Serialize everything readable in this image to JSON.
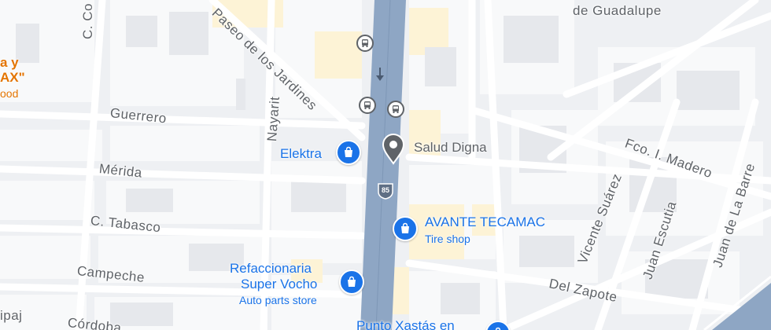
{
  "map": {
    "colors": {
      "background": "#eef0f3",
      "block": "#f8f9fa",
      "building": "#e3e6ea",
      "highlight_block": "#fdf3d6",
      "street": "#ffffff",
      "major_road": "#8ea6c4",
      "poi_blue": "#1a73e8",
      "poi_gray": "#5f6368",
      "label": "#5f6368"
    },
    "street_labels": [
      {
        "text": "C. Co",
        "angle": -90
      },
      {
        "text": "Paseo de los Jardines",
        "angle": 44
      },
      {
        "text": "Nayarit",
        "angle": -86
      },
      {
        "text": "Guerrero",
        "angle": 6
      },
      {
        "text": "Mérida",
        "angle": 6
      },
      {
        "text": "C. Tabasco",
        "angle": 6
      },
      {
        "text": "Campeche",
        "angle": 6
      },
      {
        "text": "Córdoba",
        "angle": 6
      },
      {
        "text": "Fco. I. Madero",
        "angle": 20
      },
      {
        "text": "Vicente Suárez",
        "angle": -68
      },
      {
        "text": "Juan Escutia",
        "angle": -72
      },
      {
        "text": "Juan de La Barre",
        "angle": -72
      },
      {
        "text": "Del Zapote",
        "angle": 12
      },
      {
        "text": "de Guadalupe",
        "angle": 0
      },
      {
        "text": "ipaj",
        "angle": 0
      }
    ],
    "edge_place": {
      "line1": "a y",
      "line2": "AX\"",
      "category": "ood"
    },
    "pois": [
      {
        "name": "Elektra",
        "type": "shopping",
        "color": "#1a73e8",
        "icon": "shopping-bag-icon"
      },
      {
        "name": "Salud Digna",
        "type": "place",
        "color": "#5f6368",
        "icon": "location-pin-icon"
      },
      {
        "name": "AVANTE TECAMAC",
        "category": "Tire shop",
        "type": "shopping",
        "color": "#1a73e8",
        "icon": "shopping-bag-icon"
      },
      {
        "name_line1": "Refaccionaria",
        "name_line2": "Super Vocho",
        "category": "Auto parts store",
        "type": "shopping",
        "color": "#1a73e8",
        "icon": "shopping-bag-icon"
      },
      {
        "name": "Punto Xastás en",
        "type": "shopping",
        "color": "#1a73e8",
        "icon": "shopping-bag-icon"
      }
    ],
    "highway_shield": {
      "number": "85"
    },
    "transit_stops": [
      {
        "name": "bus-stop-1",
        "icon": "bus-icon"
      },
      {
        "name": "bus-stop-2",
        "icon": "bus-icon"
      },
      {
        "name": "bus-stop-3",
        "icon": "bus-icon"
      }
    ],
    "one_way_arrow": {
      "icon": "down-arrow-icon"
    }
  }
}
